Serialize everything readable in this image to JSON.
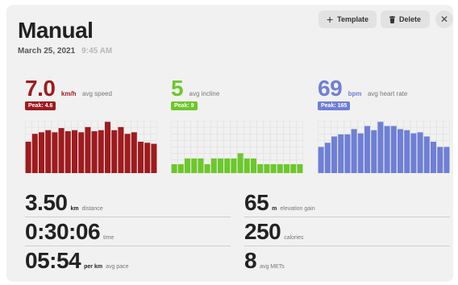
{
  "header": {
    "title": "Manual",
    "date": "March 25, 2021",
    "time": "9:45 AM",
    "template_label": "Template",
    "delete_label": "Delete",
    "close_glyph": "✕"
  },
  "colors": {
    "speed": "#9e1b1e",
    "incline": "#6cc82a",
    "heart_rate": "#6f7fd6",
    "grid": "#dcdcdc"
  },
  "icons": {
    "template": "plus-icon",
    "delete": "trash-icon",
    "close": "close-icon"
  },
  "stats": [
    {
      "key": "speed",
      "value": "7.0",
      "unit": "km/h",
      "label": "avg speed",
      "peak": "Peak: 4.6"
    },
    {
      "key": "incline",
      "value": "5",
      "unit": "",
      "label": "avg incline",
      "peak": "Peak: 9"
    },
    {
      "key": "heart_rate",
      "value": "69",
      "unit": "bpm",
      "label": "avg heart rate",
      "peak": "Peak: 165"
    }
  ],
  "chart_data": [
    {
      "type": "bar",
      "series": [
        {
          "values": [
            0.6,
            0.75,
            0.78,
            0.82,
            0.78,
            0.86,
            0.8,
            0.82,
            0.78,
            0.88,
            0.8,
            0.82,
            0.98,
            0.82,
            0.88,
            0.75,
            0.78,
            0.6,
            0.58,
            0.56
          ]
        }
      ]
    },
    {
      "type": "bar",
      "series": [
        {
          "values": [
            0.17,
            0.17,
            0.28,
            0.28,
            0.28,
            0.17,
            0.28,
            0.28,
            0.28,
            0.28,
            0.38,
            0.28,
            0.28,
            0.17,
            0.17,
            0.17,
            0.17,
            0.17,
            0.17,
            0.17
          ]
        }
      ]
    },
    {
      "type": "bar",
      "series": [
        {
          "values": [
            0.5,
            0.58,
            0.7,
            0.74,
            0.74,
            0.84,
            0.76,
            0.9,
            0.82,
            0.98,
            0.9,
            0.9,
            0.84,
            0.82,
            0.76,
            0.78,
            0.7,
            0.6,
            0.5,
            0.5
          ]
        }
      ]
    }
  ],
  "metrics": [
    {
      "value": "3.50",
      "unit": "km",
      "label": "distance"
    },
    {
      "value": "65",
      "unit": "m",
      "label": "elevation gain"
    },
    {
      "value": "0:30:06",
      "unit": "",
      "label": "time"
    },
    {
      "value": "250",
      "unit": "",
      "label": "calories"
    },
    {
      "value": "05:54",
      "unit": "per km",
      "label": "avg pace"
    },
    {
      "value": "8",
      "unit": "",
      "label": "avg METs"
    }
  ]
}
